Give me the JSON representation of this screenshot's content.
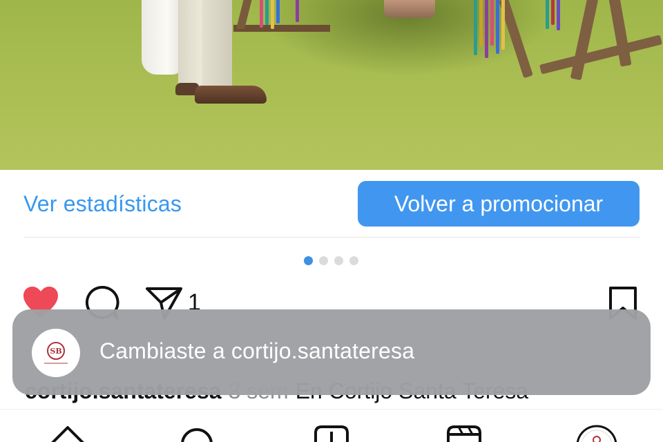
{
  "post_actions": {
    "stats_link": "Ver estadísticas",
    "promote_button": "Volver a promocionar"
  },
  "carousel": {
    "total": 4,
    "active_index": 0
  },
  "engagement": {
    "liked": true,
    "share_count": "1"
  },
  "caption": {
    "username": "cortijo.santateresa",
    "time": "3 sem",
    "text": "En Cortijo Santa Teresa"
  },
  "toast": {
    "message": "Cambiaste a cortijo.santateresa",
    "avatar_monogram": "SB"
  },
  "colors": {
    "accent": "#3797ef",
    "button_bg": "#4197ef",
    "like_red": "#ed4956",
    "toast_bg": "#9ea0a3"
  },
  "icons": {
    "like": "heart-filled-icon",
    "comment": "comment-icon",
    "share": "paper-plane-icon",
    "save": "bookmark-icon",
    "tabs": [
      "home-icon",
      "search-icon",
      "create-icon",
      "reels-icon",
      "profile-avatar"
    ]
  }
}
